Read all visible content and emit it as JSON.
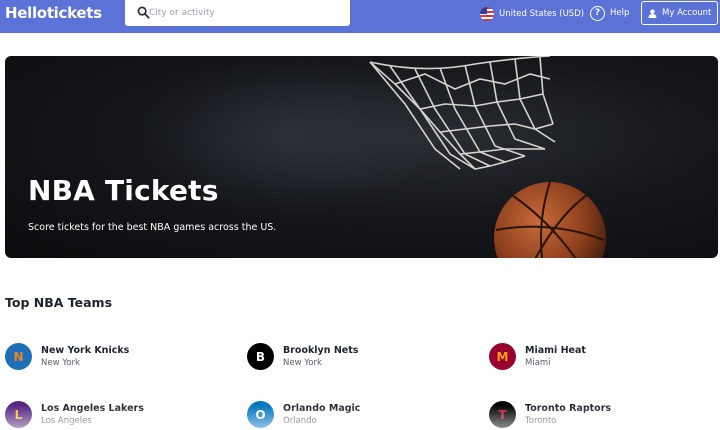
{
  "header": {
    "logo": "Hellotickets",
    "search": {
      "placeholder": "City or activity",
      "value": ""
    },
    "country_label": "United States (USD)",
    "help_label": "Help",
    "account_label": "My Account",
    "accent_color": "#5b72d6"
  },
  "hero": {
    "title": "NBA Tickets",
    "subtitle": "Score tickets for the best NBA games across the US."
  },
  "teams_section": {
    "title": "Top NBA Teams",
    "teams": [
      {
        "letter": "N",
        "name": "New York Knicks",
        "city": "New York",
        "bg": "#1d6fb8",
        "fg": "#f58426"
      },
      {
        "letter": "B",
        "name": "Brooklyn Nets",
        "city": "New York",
        "bg": "#000000",
        "fg": "#ffffff"
      },
      {
        "letter": "M",
        "name": "Miami Heat",
        "city": "Miami",
        "bg": "#98002e",
        "fg": "#f9a01b"
      },
      {
        "letter": "L",
        "name": "Los Angeles Lakers",
        "city": "Los Angeles",
        "bg": "#552583",
        "fg": "#fdb927"
      },
      {
        "letter": "O",
        "name": "Orlando Magic",
        "city": "Orlando",
        "bg": "#0077c0",
        "fg": "#ffffff"
      },
      {
        "letter": "T",
        "name": "Toronto Raptors",
        "city": "Toronto",
        "bg": "#000000",
        "fg": "#ce1141"
      }
    ]
  }
}
